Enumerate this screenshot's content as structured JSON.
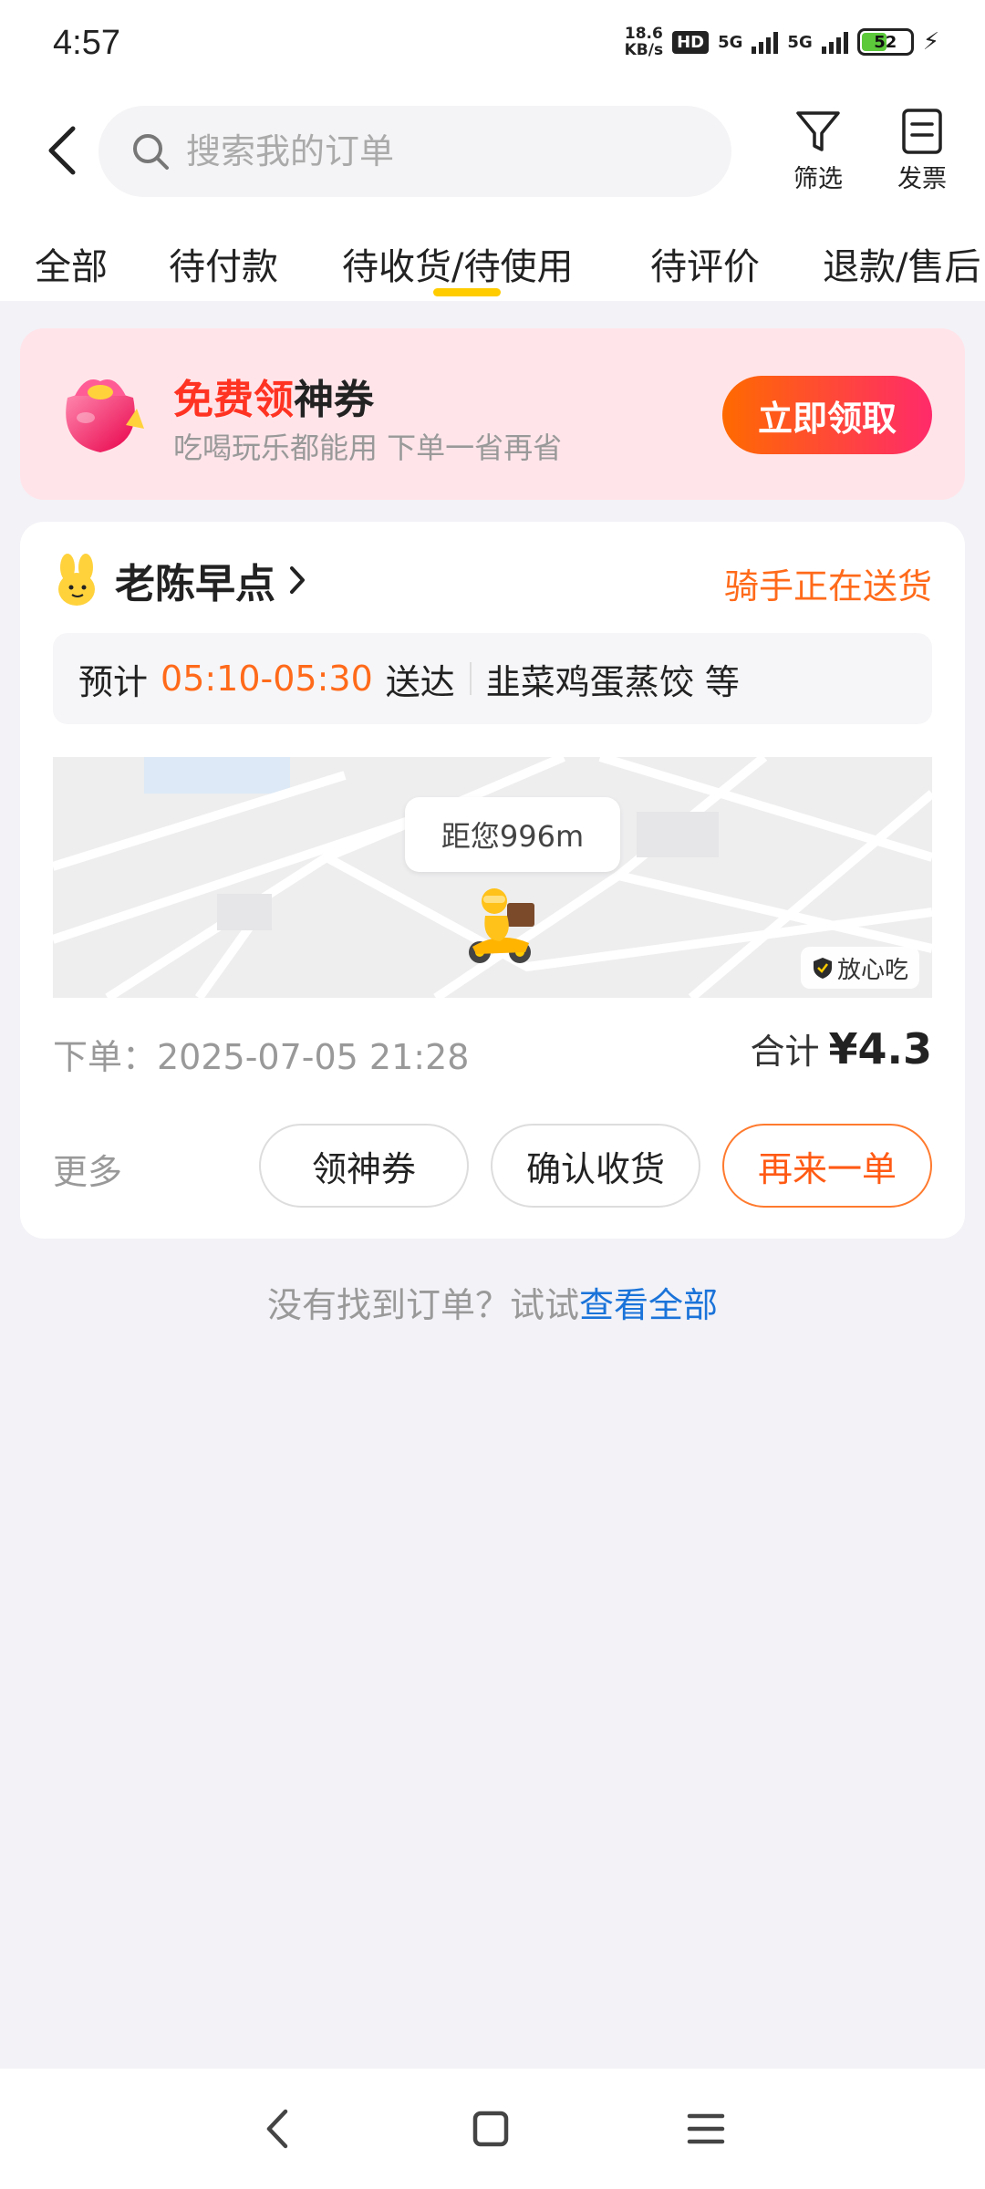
{
  "status_bar": {
    "time": "4:57",
    "net_speed_value": "18.6",
    "net_speed_unit": "KB/s",
    "hd_badge": "HD",
    "sim1_label": "5G",
    "sim2_label": "5G",
    "battery_level": "52"
  },
  "header": {
    "search_placeholder": "搜索我的订单",
    "filter_label": "筛选",
    "invoice_label": "发票"
  },
  "tabs": [
    {
      "label": "全部"
    },
    {
      "label": "待付款"
    },
    {
      "label": "待收货/待使用",
      "active": true
    },
    {
      "label": "待评价"
    },
    {
      "label": "退款/售后"
    }
  ],
  "coupon": {
    "title_highlight": "免费领",
    "title_rest": "神券",
    "subtitle": "吃喝玩乐都能用 下单一省再省",
    "button_label": "立即领取"
  },
  "order": {
    "shop_name": "老陈早点",
    "status": "骑手正在送货",
    "eta_prefix": "预计",
    "eta_time": "05:10-05:30",
    "eta_suffix": "送达",
    "items": "韭菜鸡蛋蒸饺 等",
    "distance": "距您996m",
    "safe_tag": "放心吃",
    "order_time_label": "下单：2025-07-05 21:28",
    "total_label": "合计",
    "total_amount": "¥4.3",
    "more_label": "更多",
    "btn_coupon": "领神券",
    "btn_confirm": "确认收货",
    "btn_reorder": "再来一单"
  },
  "footer_hint": {
    "text": "没有找到订单？试试",
    "link": "查看全部"
  },
  "colors": {
    "accent_orange": "#ff6a1a",
    "coupon_red": "#ff3322",
    "link_blue": "#1a73d9",
    "tab_underline": "#ffcc00"
  }
}
